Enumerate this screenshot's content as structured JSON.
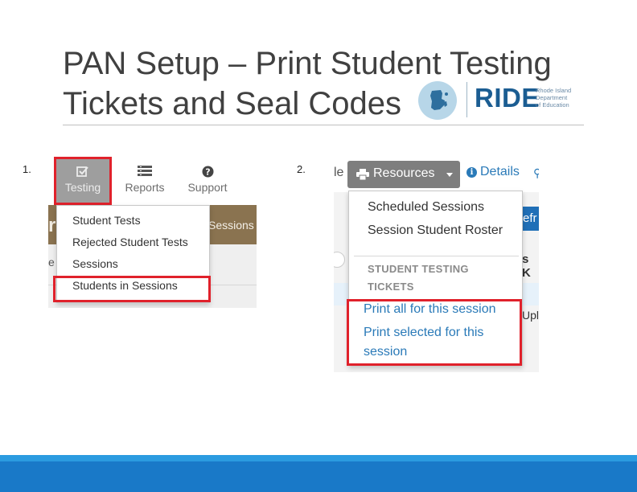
{
  "slide": {
    "title_line1": "PAN Setup – Print Student Testing",
    "title_line2": "Tickets and Seal Codes"
  },
  "logo": {
    "wordmark": "RIDE",
    "subtitle": [
      "Rhode Island",
      "Department",
      "of Education"
    ]
  },
  "steps": {
    "step1": "1.",
    "step2": "2."
  },
  "screenshot1": {
    "nav": {
      "testing": {
        "label": "Testing",
        "icon": "checkbox-icon"
      },
      "reports": {
        "label": "Reports",
        "icon": "reports-icon"
      },
      "support": {
        "label": "Support",
        "icon": "help-icon"
      }
    },
    "banner_left_fragment": "r",
    "banner_right_fragment": "Sessions",
    "grey_left_fragment": "e",
    "menu": [
      "Student Tests",
      "Rejected Student Tests",
      "Sessions",
      "Students in Sessions"
    ],
    "highlight_color": "#e0212b"
  },
  "screenshot2": {
    "left_fragment": "le",
    "resources_button": {
      "label": "Resources",
      "icon": "print-icon"
    },
    "details_link": "Details",
    "blue_button_fragment": "efr",
    "right_fragment": "s K",
    "upload_fragment": "Uplo",
    "menu_items": [
      "Scheduled Sessions",
      "Session Student Roster"
    ],
    "section_header_line1": "STUDENT TESTING",
    "section_header_line2": "TICKETS",
    "print_links": [
      "Print all for this session",
      "Print selected for this",
      "session"
    ],
    "highlight_color": "#e0212b",
    "link_color": "#2a7ab8"
  },
  "footer": {
    "band_color": "#1979c8",
    "band_accent_color": "#2b9be0"
  }
}
